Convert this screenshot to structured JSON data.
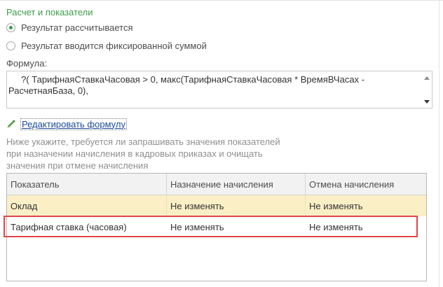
{
  "section": {
    "title": "Расчет и показатели"
  },
  "calc_mode": {
    "options": [
      {
        "label": "Результат рассчитывается",
        "checked": true
      },
      {
        "label": "Результат вводится фиксированной суммой",
        "checked": false
      }
    ]
  },
  "formula": {
    "label": "Формула:",
    "value": "     ?( ТарифнаяСтавкаЧасовая > 0, макс(ТарифнаяСтавкаЧасовая * ВремяВЧасах -\nРасчетнаяБаза, 0),"
  },
  "edit_formula": {
    "label": "Редактировать формулу",
    "icon": "pencil-icon"
  },
  "hint": {
    "text": "Ниже укажите, требуется ли запрашивать значения показателей при назначении начисления в кадровых приказах и очищать значения при отмене начисления"
  },
  "indicators_table": {
    "columns": [
      "Показатель",
      "Назначение начисления",
      "Отмена начисления"
    ],
    "rows": [
      {
        "indicator": "Оклад",
        "assignment": "Не изменять",
        "cancellation": "Не изменять"
      },
      {
        "indicator": "Тарифная ставка (часовая)",
        "assignment": "Не изменять",
        "cancellation": "Не изменять"
      }
    ]
  },
  "colors": {
    "accent_green": "#3c9b48",
    "link_blue": "#1c4a9c",
    "selected_row": "#fbefc6",
    "highlight_red": "#e0464a"
  }
}
